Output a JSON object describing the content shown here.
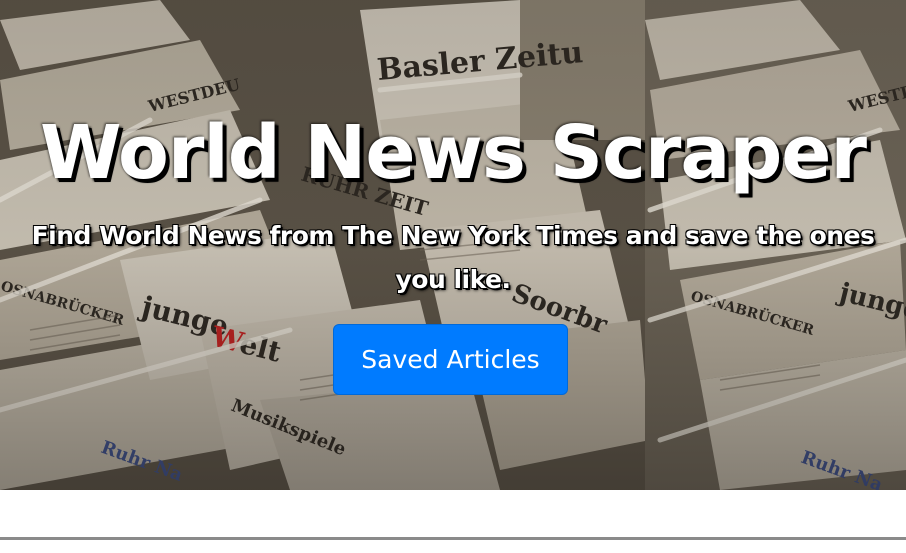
{
  "hero": {
    "title": "World News Scraper",
    "subtitle": "Find World News from The New York Times and save the ones you like.",
    "button_label": "Saved Articles",
    "background": "newspaper-rack-photo"
  },
  "newspaper_mastheads": [
    "Basler Zeitu",
    "WESTDEU",
    "OSNABRÜCKER ZEITUNG",
    "junge Welt",
    "RUHR NACHRICHTEN",
    "Ruhr Na"
  ],
  "colors": {
    "button": "#007bff",
    "title_text": "#ffffff",
    "text_shadow": "#000000"
  }
}
